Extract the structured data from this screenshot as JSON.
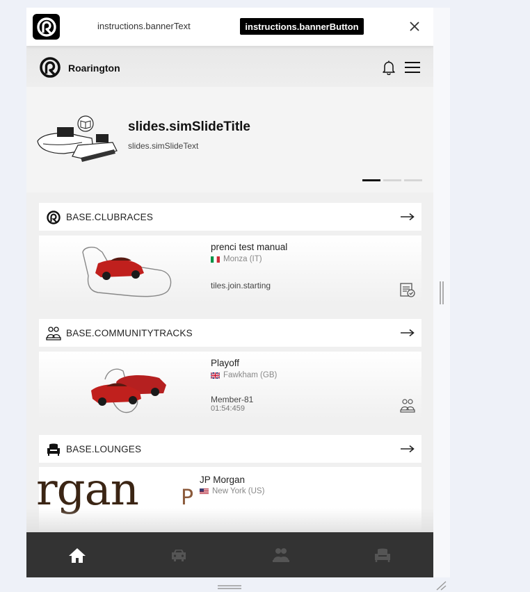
{
  "banner": {
    "text": "instructions.bannerText",
    "button": "instructions.bannerButton"
  },
  "header": {
    "title": "Roarington"
  },
  "slide": {
    "title": "slides.simSlideTitle",
    "text": "slides.simSlideText",
    "dots": 3,
    "active_dot": 0
  },
  "sections": [
    {
      "title": "BASE.CLUBRACES",
      "tile": {
        "name": "prenci test manual",
        "location": "Monza (IT)",
        "status": "tiles.join.starting"
      }
    },
    {
      "title": "BASE.COMMUNITYTRACKS",
      "tile": {
        "name": "Playoff",
        "location": "Fawkham (GB)",
        "driver": "Member-81",
        "time": "01:54:459"
      }
    },
    {
      "title": "BASE.LOUNGES",
      "tile": {
        "name": "JP Morgan",
        "location": "New York (US)",
        "logo_text": "rgan",
        "logo_p": "P"
      }
    }
  ],
  "colors": {
    "banner_button_bg": "#000000",
    "bottom_nav_bg": "#333333",
    "car_red": "#c0201d",
    "logo_brown": "#3b2514"
  },
  "bottom_nav": [
    "home-icon",
    "car-icon",
    "community-icon",
    "lounge-icon"
  ]
}
